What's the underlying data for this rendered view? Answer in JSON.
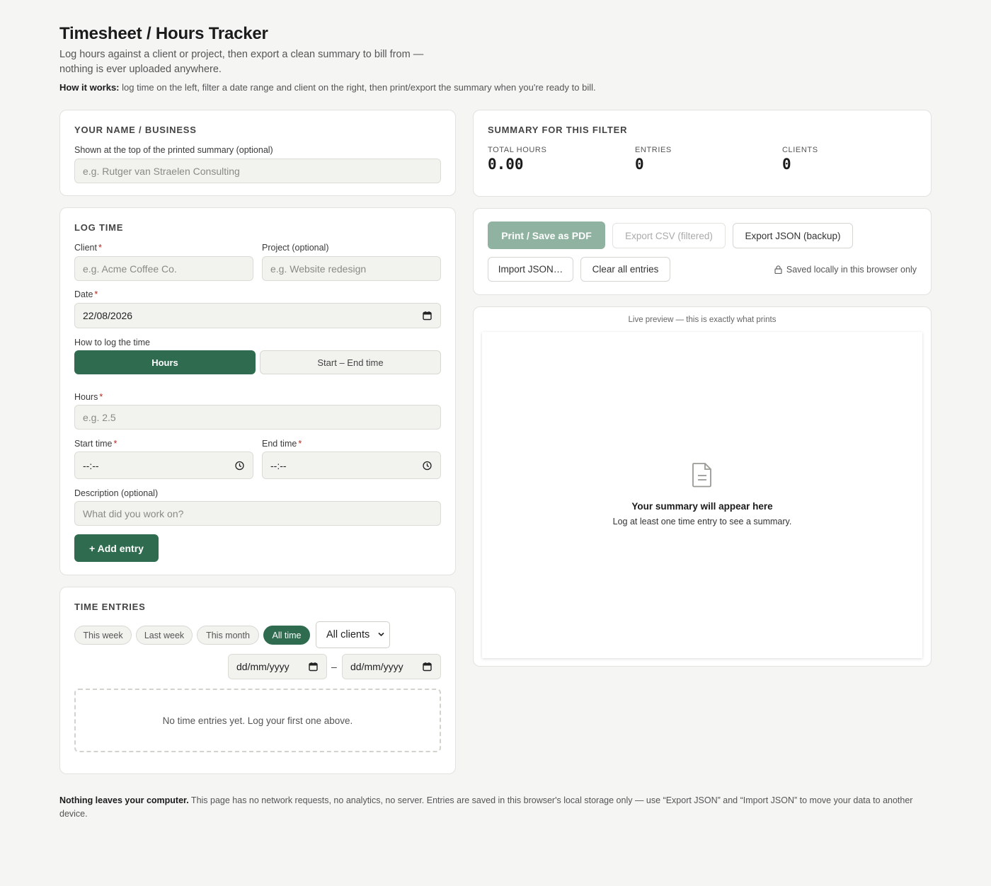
{
  "header": {
    "title": "Timesheet / Hours Tracker",
    "lede": "Log hours against a client or project, then export a clean summary to bill from — nothing is ever uploaded anywhere.",
    "howto_strong": "How it works:",
    "howto_text": " log time on the left, filter a date range and client on the right, then print/export the summary when you're ready to bill."
  },
  "business": {
    "title": "Your name / business",
    "label": "Shown at the top of the printed summary (optional)",
    "placeholder": "e.g. Rutger van Straelen Consulting"
  },
  "log": {
    "title": "Log time",
    "client_label": "Client",
    "client_placeholder": "e.g. Acme Coffee Co.",
    "project_label": "Project (optional)",
    "project_placeholder": "e.g. Website redesign",
    "date_label": "Date",
    "date_value": "22/08/2026",
    "mode_label": "How to log the time",
    "mode_hours": "Hours",
    "mode_startend": "Start – End time",
    "hours_label": "Hours",
    "hours_placeholder": "e.g. 2.5",
    "start_label": "Start time",
    "start_value": "--:--",
    "end_label": "End time",
    "end_value": "--:--",
    "desc_label": "Description (optional)",
    "desc_placeholder": "What did you work on?",
    "add_button": "+ Add entry",
    "required_mark": "*"
  },
  "entries": {
    "title": "Time entries",
    "filters": [
      "This week",
      "Last week",
      "This month",
      "All time"
    ],
    "active_filter": "All time",
    "client_select": "All clients",
    "date_from": "dd/mm/yyyy",
    "date_sep": "–",
    "date_to": "dd/mm/yyyy",
    "empty": "No time entries yet. Log your first one above."
  },
  "summary": {
    "title": "Summary for this filter",
    "total_hours_label": "Total hours",
    "total_hours": "0.00",
    "entries_label": "Entries",
    "entries": "0",
    "clients_label": "Clients",
    "clients": "0"
  },
  "actions": {
    "print": "Print / Save as PDF",
    "export_csv": "Export CSV (filtered)",
    "export_json": "Export JSON (backup)",
    "import_json": "Import JSON…",
    "clear": "Clear all entries",
    "saved_note": "Saved locally in this browser only"
  },
  "preview": {
    "caption": "Live preview — this is exactly what prints",
    "empty_title": "Your summary will appear here",
    "empty_text": "Log at least one time entry to see a summary."
  },
  "footer": {
    "strong": "Nothing leaves your computer.",
    "text": " This page has no network requests, no analytics, no server. Entries are saved in this browser's local storage only — use “Export JSON” and “Import JSON” to move your data to another device."
  },
  "colors": {
    "accent": "#2f6b4f",
    "accent_disabled": "#8fb3a0",
    "page_bg": "#f5f5f3",
    "required": "#b3261e"
  },
  "icons": [
    "calendar-icon",
    "clock-icon",
    "lock-icon",
    "document-icon",
    "select-chevron-icon"
  ]
}
